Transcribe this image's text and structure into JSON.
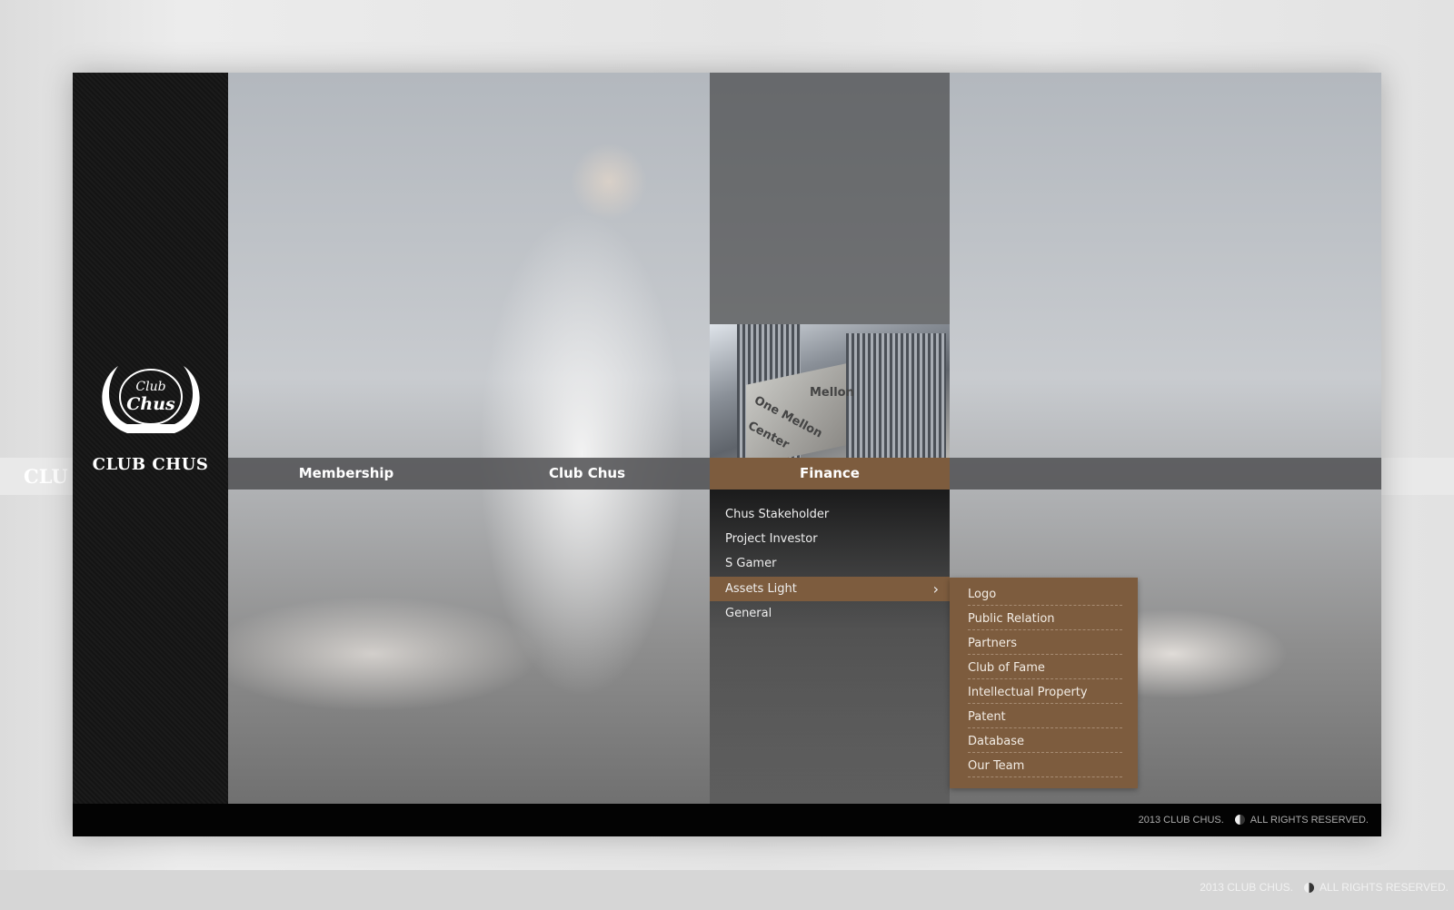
{
  "brand": {
    "name": "CLUB CHUS",
    "logo_text": "Club Chus"
  },
  "nav": [
    {
      "label": "Membership"
    },
    {
      "label": "Club Chus"
    },
    {
      "label": "Finance",
      "active": true
    }
  ],
  "building_sign": {
    "line1": "One Mellon",
    "line2": "Center",
    "plaque": "Mellon"
  },
  "dropdown": [
    {
      "label": "Chus Stakeholder"
    },
    {
      "label": "Project Investor"
    },
    {
      "label": "S Gamer"
    },
    {
      "label": "Assets Light",
      "highlighted": true,
      "has_submenu": true
    },
    {
      "label": "General"
    }
  ],
  "submenu": [
    {
      "label": "Logo"
    },
    {
      "label": "Public Relation"
    },
    {
      "label": "Partners"
    },
    {
      "label": "Club of Fame"
    },
    {
      "label": "Intellectual Property"
    },
    {
      "label": "Patent"
    },
    {
      "label": "Database"
    },
    {
      "label": "Our Team"
    }
  ],
  "footer": {
    "left": "2013 CLUB CHUS.",
    "right": "ALL RIGHTS RESERVED.",
    "icon": "yin-yang-icon"
  },
  "colors": {
    "accent": "#7d5c3e",
    "sidebar": "#141414",
    "footer": "#030303"
  }
}
